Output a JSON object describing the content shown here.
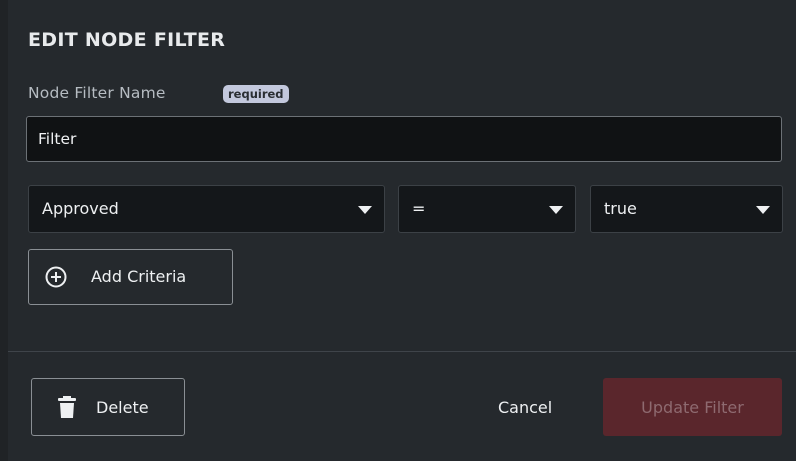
{
  "dialog": {
    "title": "EDIT NODE FILTER",
    "name_label": "Node Filter Name",
    "required_badge": "required",
    "name_value": "Filter"
  },
  "criteria": {
    "field": "Approved",
    "operator": "=",
    "value": "true"
  },
  "add_criteria_label": "Add Criteria",
  "footer": {
    "delete_label": "Delete",
    "cancel_label": "Cancel",
    "update_label": "Update Filter"
  },
  "colors": {
    "background": "#25292d",
    "input_background": "#101214",
    "update_button_disabled": "#5a262c",
    "badge": "#c3c8dd"
  },
  "icons": {
    "add": "plus-circle-icon",
    "delete": "trash-icon",
    "dropdown": "caret-down-icon"
  }
}
